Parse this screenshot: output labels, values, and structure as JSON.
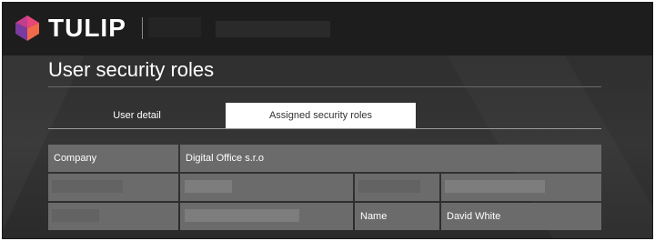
{
  "header": {
    "brand": "TULIP"
  },
  "page": {
    "title": "User security roles"
  },
  "tabs": [
    {
      "label": "User detail",
      "active": false
    },
    {
      "label": "Assigned security roles",
      "active": true
    }
  ],
  "details": {
    "company_label": "Company",
    "company_value": "Digital Office s.r.o",
    "name_label": "Name",
    "name_value": "David White"
  },
  "colors": {
    "header_bg": "#1d1d1d",
    "cell_bg": "#6b6b6b",
    "active_tab_bg": "#ffffff"
  }
}
